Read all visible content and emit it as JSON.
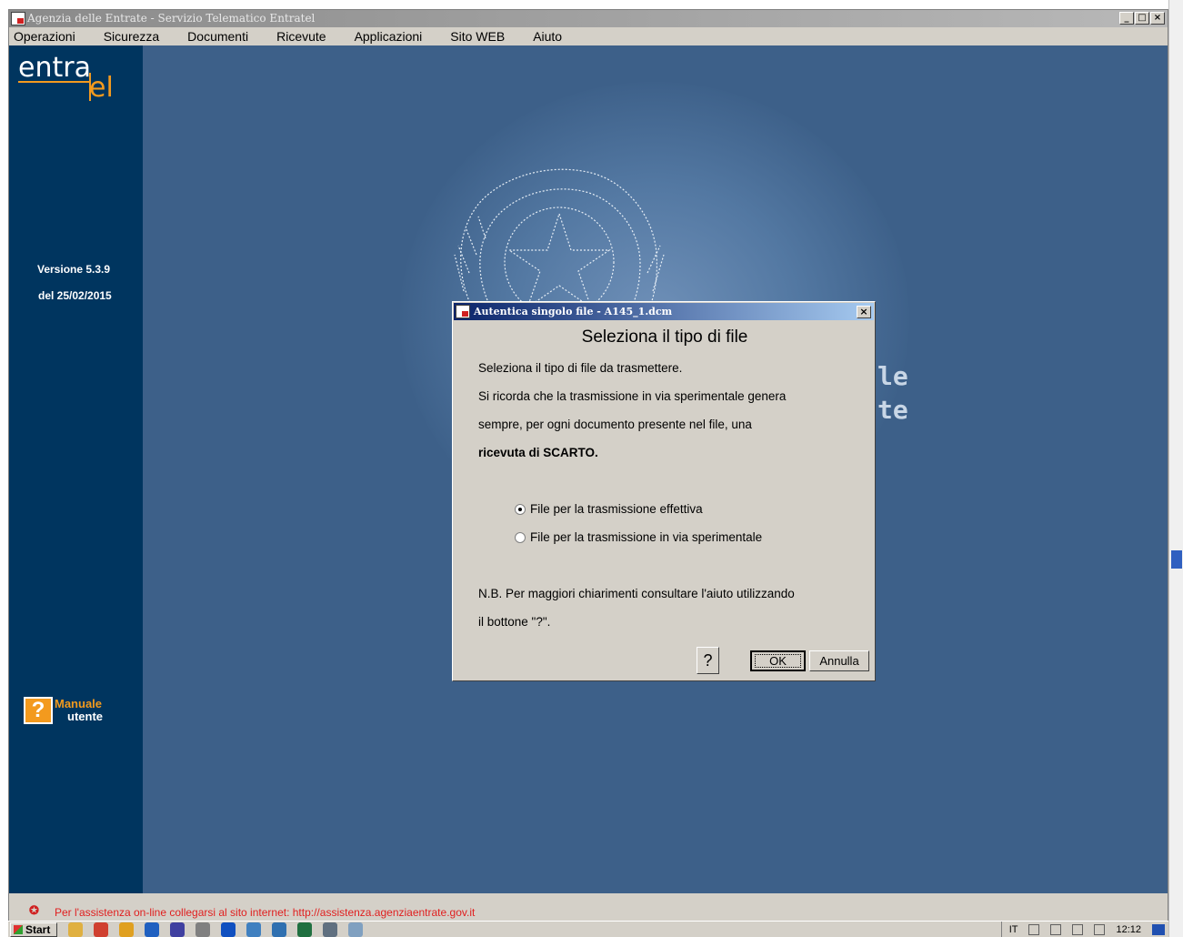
{
  "window": {
    "title": "Agenzia delle Entrate - Servizio Telematico Entratel",
    "minimize": "_",
    "maximize": "□",
    "close": "×"
  },
  "menu": [
    "Operazioni",
    "Sicurezza",
    "Documenti",
    "Ricevute",
    "Applicazioni",
    "Sito WEB",
    "Aiuto"
  ],
  "sidebar": {
    "logo_line1": "entra",
    "logo_line2": "el",
    "version": "Versione 5.3.9",
    "date": "del 25/02/2015",
    "manual_line1": "Manuale",
    "manual_line2": "utente",
    "manual_icon": "?"
  },
  "background_letters": {
    "line1": "le",
    "line2": "te"
  },
  "status": {
    "support_text": "Per l'assistenza on-line collegarsi al sito internet: http://assistenza.agenziaentrate.gov.it"
  },
  "dialog": {
    "title": "Autentica singolo file - A145_1.dcm",
    "close": "×",
    "heading": "Seleziona il tipo di file",
    "text1": "Seleziona il tipo di file da trasmettere.",
    "text2": "Si ricorda che la trasmissione in via sperimentale genera",
    "text3": "sempre,  per  ogni documento  presente nel file,  una",
    "text4": "ricevuta di SCARTO.",
    "options": [
      {
        "label": "File per la trasmissione effettiva",
        "checked": true
      },
      {
        "label": "File per la trasmissione in via sperimentale",
        "checked": false
      }
    ],
    "note1": "N.B.  Per maggiori chiarimenti consultare l'aiuto utilizzando",
    "note2": "il bottone \"?\".",
    "help_button": "?",
    "ok_button": "OK",
    "cancel_button": "Annulla"
  },
  "taskbar": {
    "start": "Start",
    "lang": "IT",
    "clock": "12:12",
    "icons": [
      {
        "name": "folder-icon",
        "color": "#e0b040"
      },
      {
        "name": "chrome-icon",
        "color": "#d04030"
      },
      {
        "name": "outlook-icon",
        "color": "#e0a020"
      },
      {
        "name": "safari-icon",
        "color": "#2060c0"
      },
      {
        "name": "tool-icon",
        "color": "#4040a0"
      },
      {
        "name": "paint-icon",
        "color": "#808080"
      },
      {
        "name": "ie-icon",
        "color": "#1050c0"
      },
      {
        "name": "shield-icon",
        "color": "#4080c0"
      },
      {
        "name": "gear-icon",
        "color": "#3070b0"
      },
      {
        "name": "excel-icon",
        "color": "#207040"
      },
      {
        "name": "window-icon",
        "color": "#607080"
      },
      {
        "name": "mail-icon",
        "color": "#80a0c0"
      }
    ]
  }
}
